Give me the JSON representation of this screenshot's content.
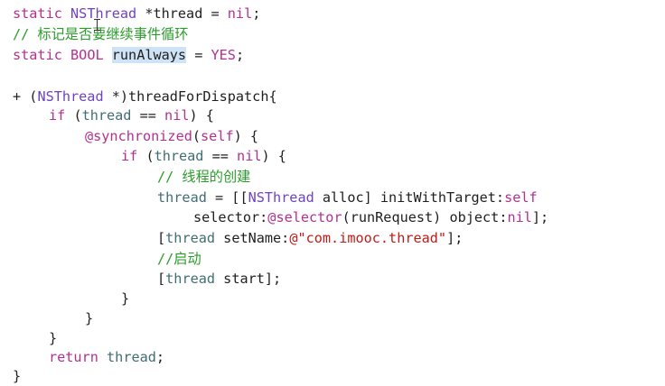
{
  "editor": {
    "lines": [
      {
        "text": "static NSThread *thread = nil;"
      },
      {
        "text": "// 标记是否要继续事件循环"
      },
      {
        "text": "static BOOL runAlways = YES;"
      },
      {
        "text": ""
      },
      {
        "text": "+ (NSThread *)threadForDispatch{"
      },
      {
        "text": "if (thread == nil) {"
      },
      {
        "text": "@synchronized(self) {"
      },
      {
        "text": "if (thread == nil) {"
      },
      {
        "text": "// 线程的创建"
      },
      {
        "text": "thread = [[NSThread alloc] initWithTarget:self"
      },
      {
        "text": "selector:@selector(runRequest) object:nil];"
      },
      {
        "text": "[thread setName:@\"com.imooc.thread\"];"
      },
      {
        "text": "//启动"
      },
      {
        "text": "[thread start];"
      },
      {
        "text": "}"
      },
      {
        "text": "}"
      },
      {
        "text": "}"
      },
      {
        "text": "return thread;"
      },
      {
        "text": "}"
      }
    ],
    "selected_token": "runAlways"
  },
  "colors": {
    "keyword": "#b3308f",
    "type": "#6f42c1",
    "string": "#c41a16",
    "comment": "#2a9d2a",
    "variable": "#3f6e74",
    "selection": "#cfe3f7"
  }
}
